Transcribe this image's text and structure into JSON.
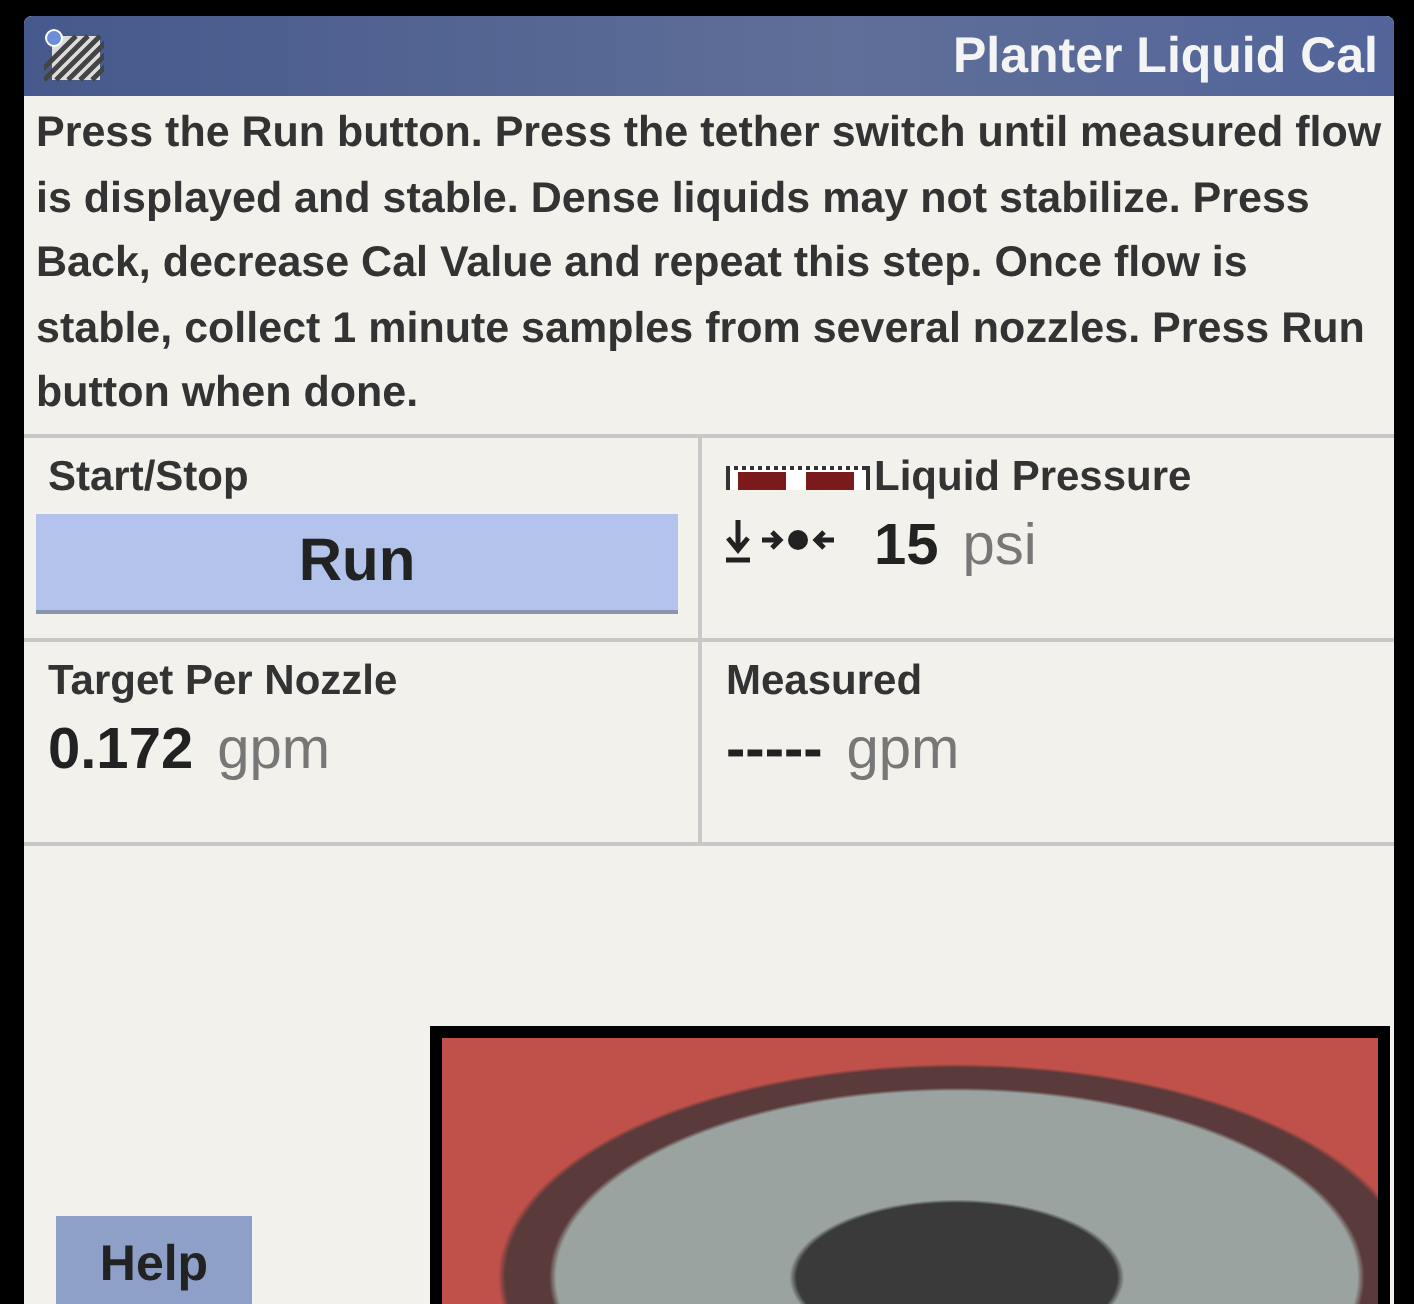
{
  "title": "Planter Liquid Cal",
  "instructions": "Press the Run button. Press the tether switch until measured flow is displayed and stable. Dense liquids may not stabilize. Press Back, decrease Cal Value and repeat this step. Once flow is stable, collect 1 minute samples from several nozzles. Press Run button when done.",
  "start_stop": {
    "label": "Start/Stop",
    "button": "Run"
  },
  "liquid_pressure": {
    "label": "Liquid Pressure",
    "value": "15",
    "unit": "psi"
  },
  "target_per_nozzle": {
    "label": "Target Per Nozzle",
    "value": "0.172",
    "unit": "gpm"
  },
  "measured": {
    "label": "Measured",
    "value": "-----",
    "unit": "gpm"
  },
  "help_button": "Help"
}
